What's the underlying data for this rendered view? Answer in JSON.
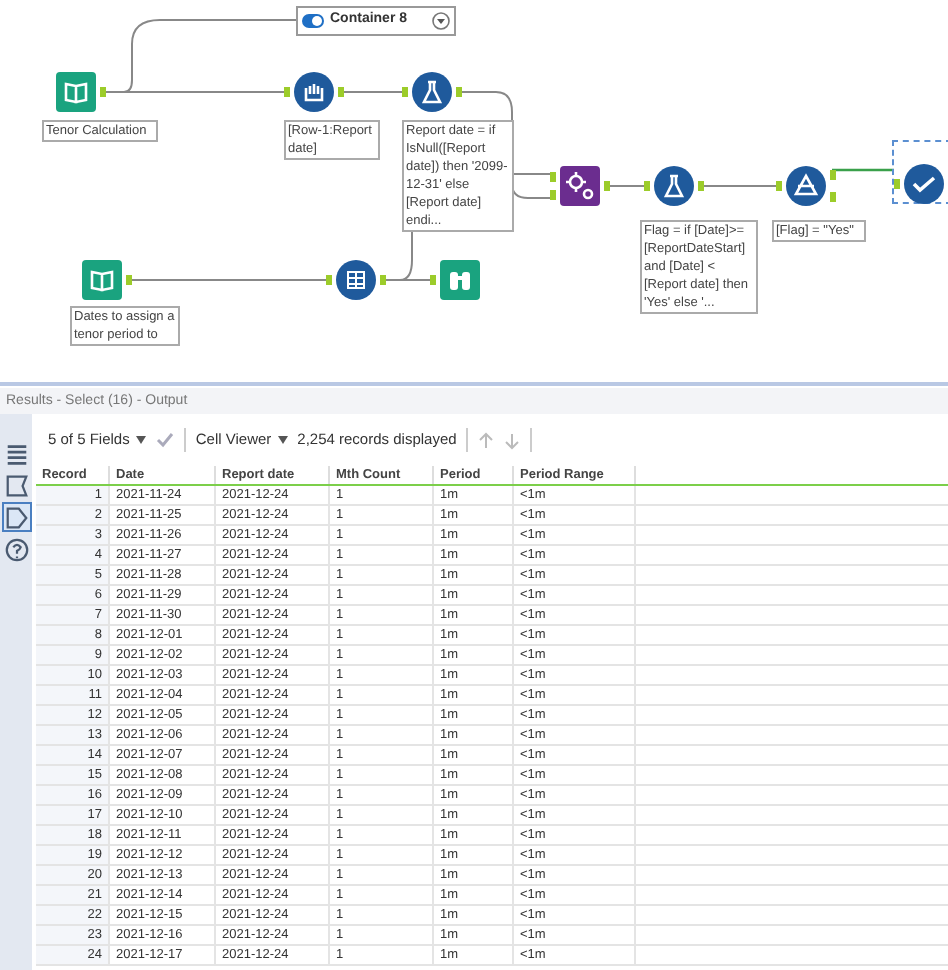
{
  "container": {
    "title": "Container 8",
    "enabled": true
  },
  "nodes": [
    {
      "kind": "input",
      "label": "Tenor Calculation"
    },
    {
      "kind": "sample",
      "label": "[Row-1:Report date]"
    },
    {
      "kind": "formula",
      "label": "Report date = if IsNull([Report date]) then '2099-12-31' else [Report date] endi..."
    },
    {
      "kind": "macro"
    },
    {
      "kind": "formula",
      "label": "Flag = if [Date]>= [ReportDateStart] and [Date] < [Report date] then 'Yes' else '..."
    },
    {
      "kind": "filter",
      "label": "[Flag] = \"Yes\""
    },
    {
      "kind": "select"
    },
    {
      "kind": "input",
      "label": "Dates to assign a tenor period to"
    },
    {
      "kind": "join"
    },
    {
      "kind": "browse"
    }
  ],
  "results": {
    "title": "Results - Select (16) - Output",
    "fields_menu": "5 of 5 Fields",
    "viewer_menu": "Cell Viewer",
    "record_count": "2,254 records displayed"
  },
  "sidebar": [
    {
      "kind": "grid",
      "selected": false
    },
    {
      "kind": "flag",
      "selected": false
    },
    {
      "kind": "tag",
      "selected": true
    },
    {
      "kind": "help",
      "selected": false
    }
  ],
  "table": {
    "columns": [
      "Record",
      "Date",
      "Report date",
      "Mth Count",
      "Period",
      "Period Range"
    ],
    "rows": [
      [
        "1",
        "2021-11-24",
        "2021-12-24",
        "1",
        "1m",
        "<1m"
      ],
      [
        "2",
        "2021-11-25",
        "2021-12-24",
        "1",
        "1m",
        "<1m"
      ],
      [
        "3",
        "2021-11-26",
        "2021-12-24",
        "1",
        "1m",
        "<1m"
      ],
      [
        "4",
        "2021-11-27",
        "2021-12-24",
        "1",
        "1m",
        "<1m"
      ],
      [
        "5",
        "2021-11-28",
        "2021-12-24",
        "1",
        "1m",
        "<1m"
      ],
      [
        "6",
        "2021-11-29",
        "2021-12-24",
        "1",
        "1m",
        "<1m"
      ],
      [
        "7",
        "2021-11-30",
        "2021-12-24",
        "1",
        "1m",
        "<1m"
      ],
      [
        "8",
        "2021-12-01",
        "2021-12-24",
        "1",
        "1m",
        "<1m"
      ],
      [
        "9",
        "2021-12-02",
        "2021-12-24",
        "1",
        "1m",
        "<1m"
      ],
      [
        "10",
        "2021-12-03",
        "2021-12-24",
        "1",
        "1m",
        "<1m"
      ],
      [
        "11",
        "2021-12-04",
        "2021-12-24",
        "1",
        "1m",
        "<1m"
      ],
      [
        "12",
        "2021-12-05",
        "2021-12-24",
        "1",
        "1m",
        "<1m"
      ],
      [
        "13",
        "2021-12-06",
        "2021-12-24",
        "1",
        "1m",
        "<1m"
      ],
      [
        "14",
        "2021-12-07",
        "2021-12-24",
        "1",
        "1m",
        "<1m"
      ],
      [
        "15",
        "2021-12-08",
        "2021-12-24",
        "1",
        "1m",
        "<1m"
      ],
      [
        "16",
        "2021-12-09",
        "2021-12-24",
        "1",
        "1m",
        "<1m"
      ],
      [
        "17",
        "2021-12-10",
        "2021-12-24",
        "1",
        "1m",
        "<1m"
      ],
      [
        "18",
        "2021-12-11",
        "2021-12-24",
        "1",
        "1m",
        "<1m"
      ],
      [
        "19",
        "2021-12-12",
        "2021-12-24",
        "1",
        "1m",
        "<1m"
      ],
      [
        "20",
        "2021-12-13",
        "2021-12-24",
        "1",
        "1m",
        "<1m"
      ],
      [
        "21",
        "2021-12-14",
        "2021-12-24",
        "1",
        "1m",
        "<1m"
      ],
      [
        "22",
        "2021-12-15",
        "2021-12-24",
        "1",
        "1m",
        "<1m"
      ],
      [
        "23",
        "2021-12-16",
        "2021-12-24",
        "1",
        "1m",
        "<1m"
      ],
      [
        "24",
        "2021-12-17",
        "2021-12-24",
        "1",
        "1m",
        "<1m"
      ]
    ]
  }
}
